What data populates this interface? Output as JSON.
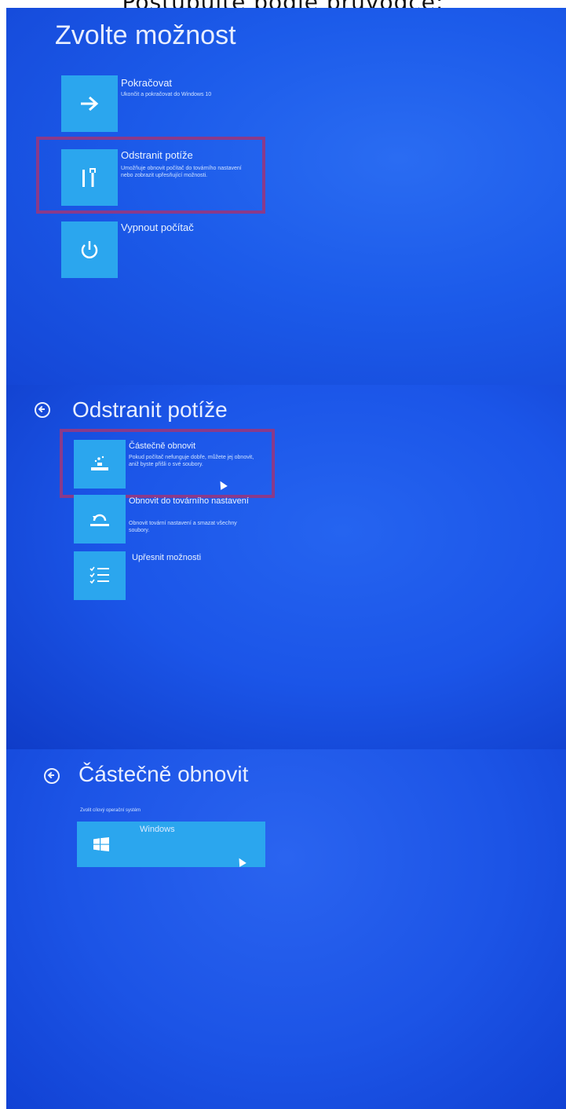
{
  "caption": "Postupujte podle průvodce:",
  "panel1": {
    "heading": "Zvolte možnost",
    "options": [
      {
        "title": "Pokračovat",
        "desc": "Ukončit a pokračovat do Windows 10",
        "icon": "arrow-right-icon"
      },
      {
        "title": "Odstranit potíže",
        "desc": "Umožňuje obnovit počítač do továrního nastavení nebo zobrazit upřesňující možnosti.",
        "icon": "tools-icon"
      },
      {
        "title": "Vypnout počítač",
        "desc": "",
        "icon": "power-icon"
      }
    ]
  },
  "panel2": {
    "heading": "Odstranit potíže",
    "options": [
      {
        "title": "Částečně obnovit",
        "desc": "Pokud počítač nefunguje dobře, můžete jej obnovit, aniž byste přišli o své soubory.",
        "icon": "refresh-icon"
      },
      {
        "title": "Obnovit do továrního nastavení",
        "desc": "Obnovit tovární nastavení a smazat všechny soubory.",
        "icon": "reset-icon"
      },
      {
        "title": "Upřesnit možnosti",
        "desc": "",
        "icon": "checklist-icon"
      }
    ]
  },
  "panel3": {
    "heading": "Částečně obnovit",
    "subtitle": "Zvolit cílový operační systém",
    "option": {
      "title": "Windows",
      "icon": "windows-logo-icon"
    }
  },
  "colors": {
    "tile": "#2ba6ee",
    "highlight": "#8a3a8a",
    "background": "#1b55e8"
  }
}
